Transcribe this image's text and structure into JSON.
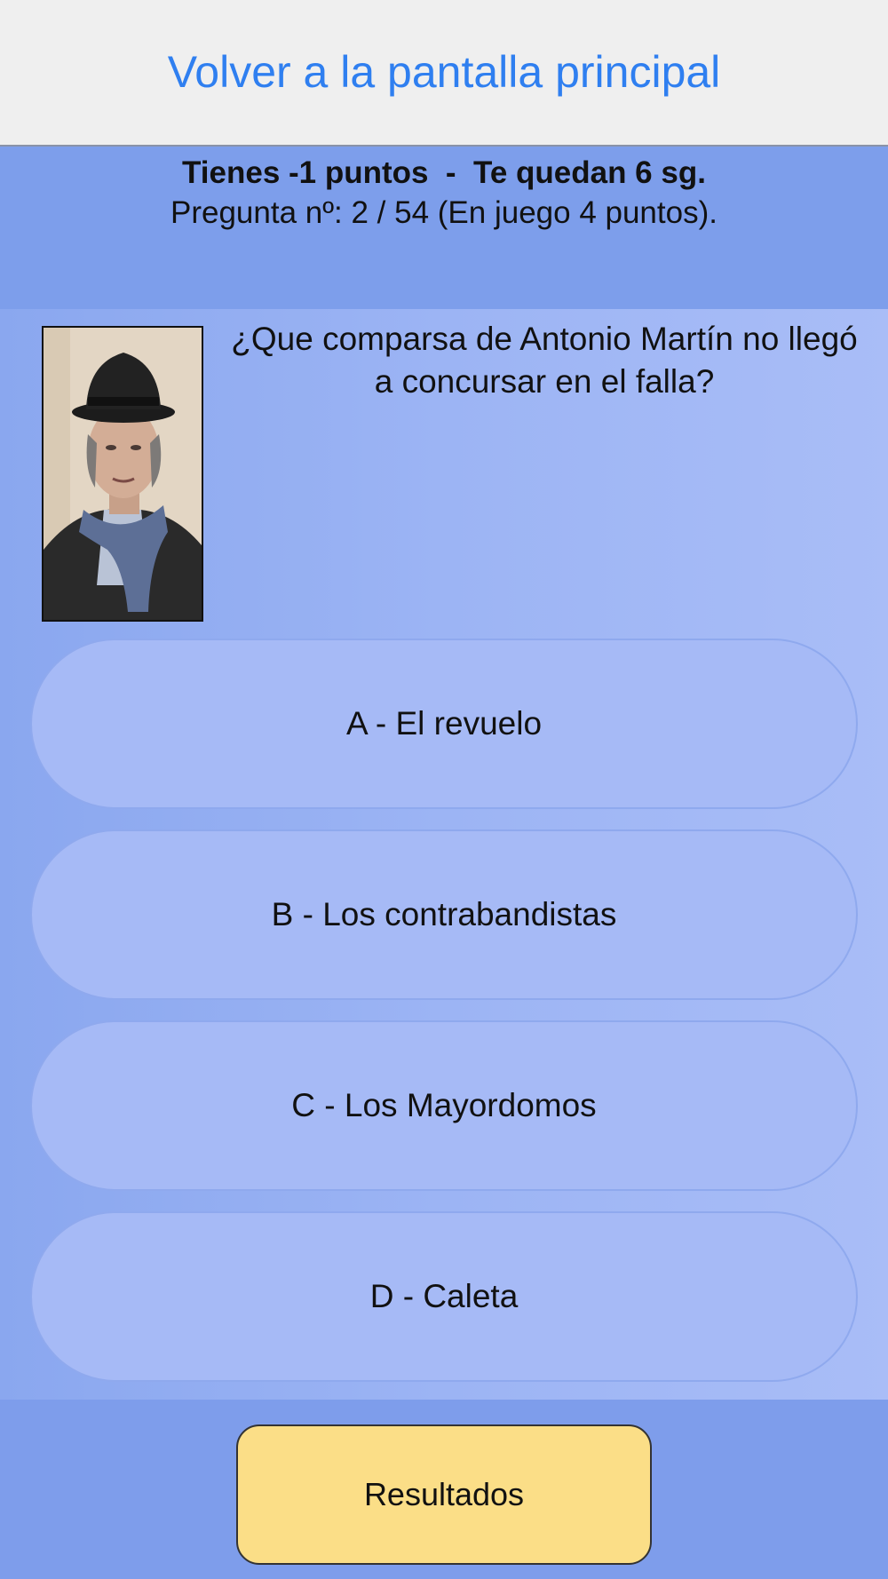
{
  "header": {
    "back_link": "Volver a la pantalla principal"
  },
  "status": {
    "score_line": "Tienes -1 puntos  -  Te quedan 6 sg.",
    "question_line": "Pregunta nº: 2 / 54 (En juego 4 puntos)."
  },
  "question": {
    "text": "¿Que comparsa de Antonio Martín no llegó a concursar en el falla?"
  },
  "answers": [
    {
      "label": "A - El revuelo"
    },
    {
      "label": "B - Los contrabandistas"
    },
    {
      "label": "C - Los Mayordomos"
    },
    {
      "label": "D - Caleta"
    }
  ],
  "footer": {
    "results_label": "Resultados"
  },
  "colors": {
    "link": "#2f7ff0",
    "answer_bg": "#a6baf6",
    "results_bg": "#fbde87"
  }
}
